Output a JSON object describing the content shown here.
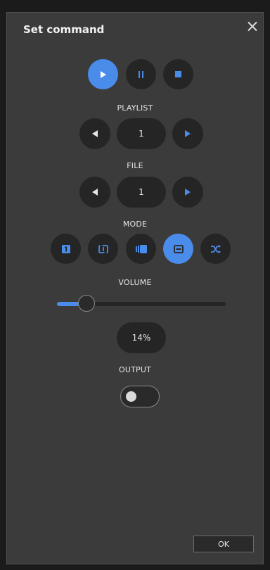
{
  "dialog": {
    "title": "Set command",
    "close_icon": "close-icon"
  },
  "transport": {
    "play": {
      "icon": "play-icon",
      "active": true
    },
    "pause": {
      "icon": "pause-icon",
      "active": false
    },
    "stop": {
      "icon": "stop-icon",
      "active": false
    }
  },
  "playlist": {
    "label": "PLAYLIST",
    "value": "1",
    "prev_icon": "previous-icon",
    "next_icon": "next-icon"
  },
  "file": {
    "label": "FILE",
    "value": "1",
    "prev_icon": "previous-icon",
    "next_icon": "next-icon"
  },
  "mode": {
    "label": "MODE",
    "options": [
      {
        "icon": "play-once-icon",
        "active": false
      },
      {
        "icon": "repeat-one-icon",
        "active": false
      },
      {
        "icon": "play-all-icon",
        "active": false
      },
      {
        "icon": "repeat-all-icon",
        "active": true
      },
      {
        "icon": "shuffle-icon",
        "active": false
      }
    ]
  },
  "volume": {
    "label": "VOLUME",
    "level": 0.14,
    "display": "14%"
  },
  "output": {
    "label": "OUTPUT",
    "enabled": false
  },
  "footer": {
    "ok_label": "OK"
  },
  "colors": {
    "accent": "#4a8ce9",
    "panel": "#3b3b3b",
    "control": "#252525"
  }
}
